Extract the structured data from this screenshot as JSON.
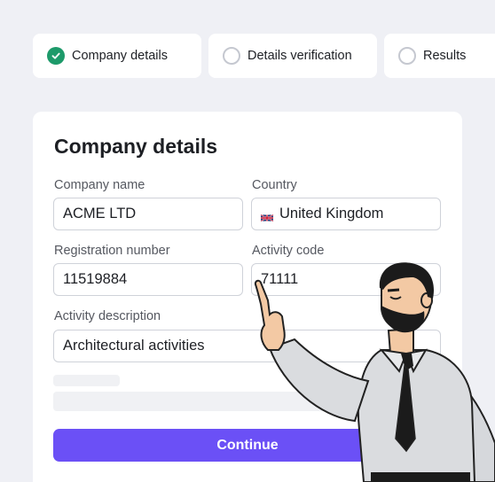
{
  "steps": [
    {
      "label": "Company details",
      "state": "complete"
    },
    {
      "label": "Details verification",
      "state": "pending"
    },
    {
      "label": "Results",
      "state": "pending"
    }
  ],
  "form": {
    "title": "Company details",
    "company_name": {
      "label": "Company name",
      "value": "ACME LTD"
    },
    "country": {
      "label": "Country",
      "value": "United Kingdom",
      "flag_icon": "uk-flag-icon"
    },
    "registration_number": {
      "label": "Registration number",
      "value": "11519884"
    },
    "activity_code": {
      "label": "Activity code",
      "value": "71111"
    },
    "activity_description": {
      "label": "Activity description",
      "value": "Architectural activities"
    },
    "continue_label": "Continue"
  },
  "colors": {
    "accent": "#6b50f6",
    "success": "#1d9a6a",
    "background": "#eff0f5"
  }
}
